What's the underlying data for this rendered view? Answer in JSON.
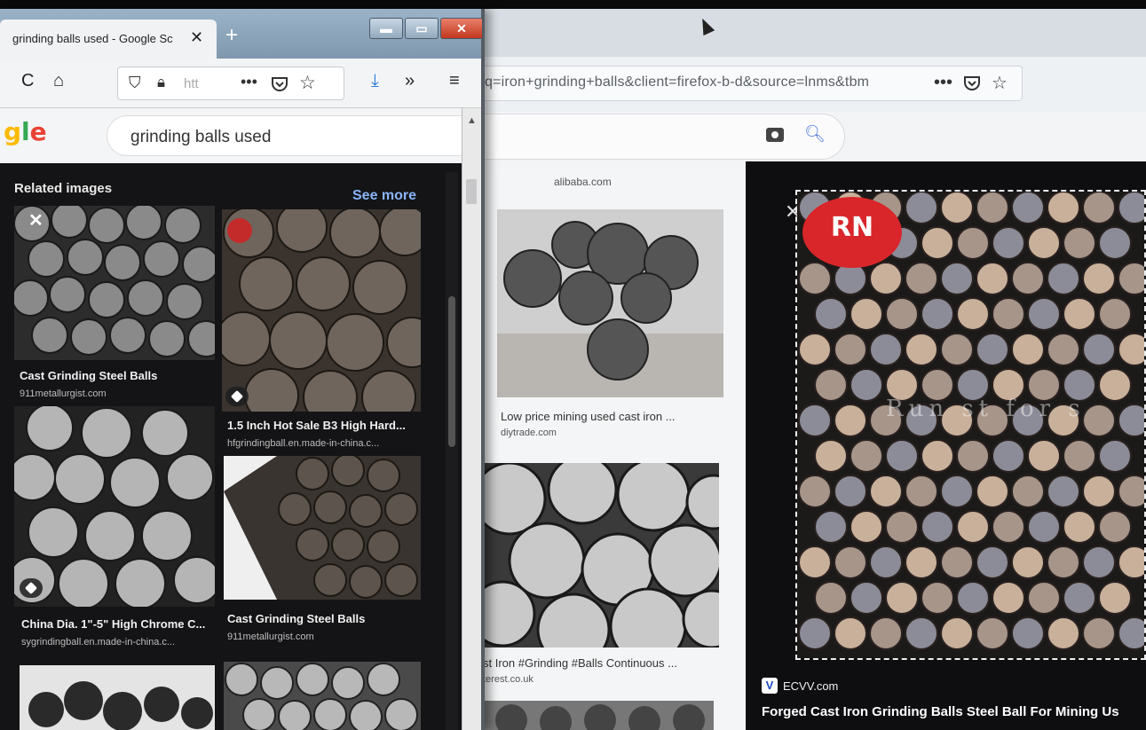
{
  "front_window": {
    "tab_title": "grinding balls used - Google Sc",
    "url_partial": "htt",
    "search_query": "grinding balls used",
    "logo_text": "gle",
    "related": {
      "heading": "Related images",
      "see_more": "See more",
      "cards": [
        {
          "title": "Cast Grinding Steel Balls",
          "source": "911metallurgist.com"
        },
        {
          "title": "1.5 Inch Hot Sale B3 High Hard...",
          "source": "hfgrindingball.en.made-in-china.c..."
        },
        {
          "title": "China Dia. 1\"-5\" High Chrome C...",
          "source": "sygrindingball.en.made-in-china.c..."
        },
        {
          "title": "Cast Grinding Steel Balls",
          "source": "911metallurgist.com"
        }
      ]
    }
  },
  "back_window": {
    "url_text": "q=iron+grinding+balls&client=firefox-b-d&source=lnms&tbm",
    "results": [
      {
        "source": "alibaba.com"
      },
      {
        "title": "Low price mining used cast iron ...",
        "source": "diytrade.com"
      },
      {
        "title": "st Iron #Grinding #Balls Continuous ...",
        "source": "terest.co.uk"
      }
    ],
    "preview": {
      "source": "ECVV.com",
      "title": "Forged Cast Iron Grinding Balls Steel Ball For Mining Us",
      "logo_text": "RN",
      "watermark": "Run    st  for  s"
    }
  },
  "icons": [
    "close-icon",
    "plus-icon",
    "reload-icon",
    "home-icon",
    "shield-icon",
    "lock-icon",
    "more-icon",
    "pocket-icon",
    "star-icon",
    "download-icon",
    "overflow-icon",
    "menu-icon",
    "camera-icon",
    "search-icon"
  ]
}
